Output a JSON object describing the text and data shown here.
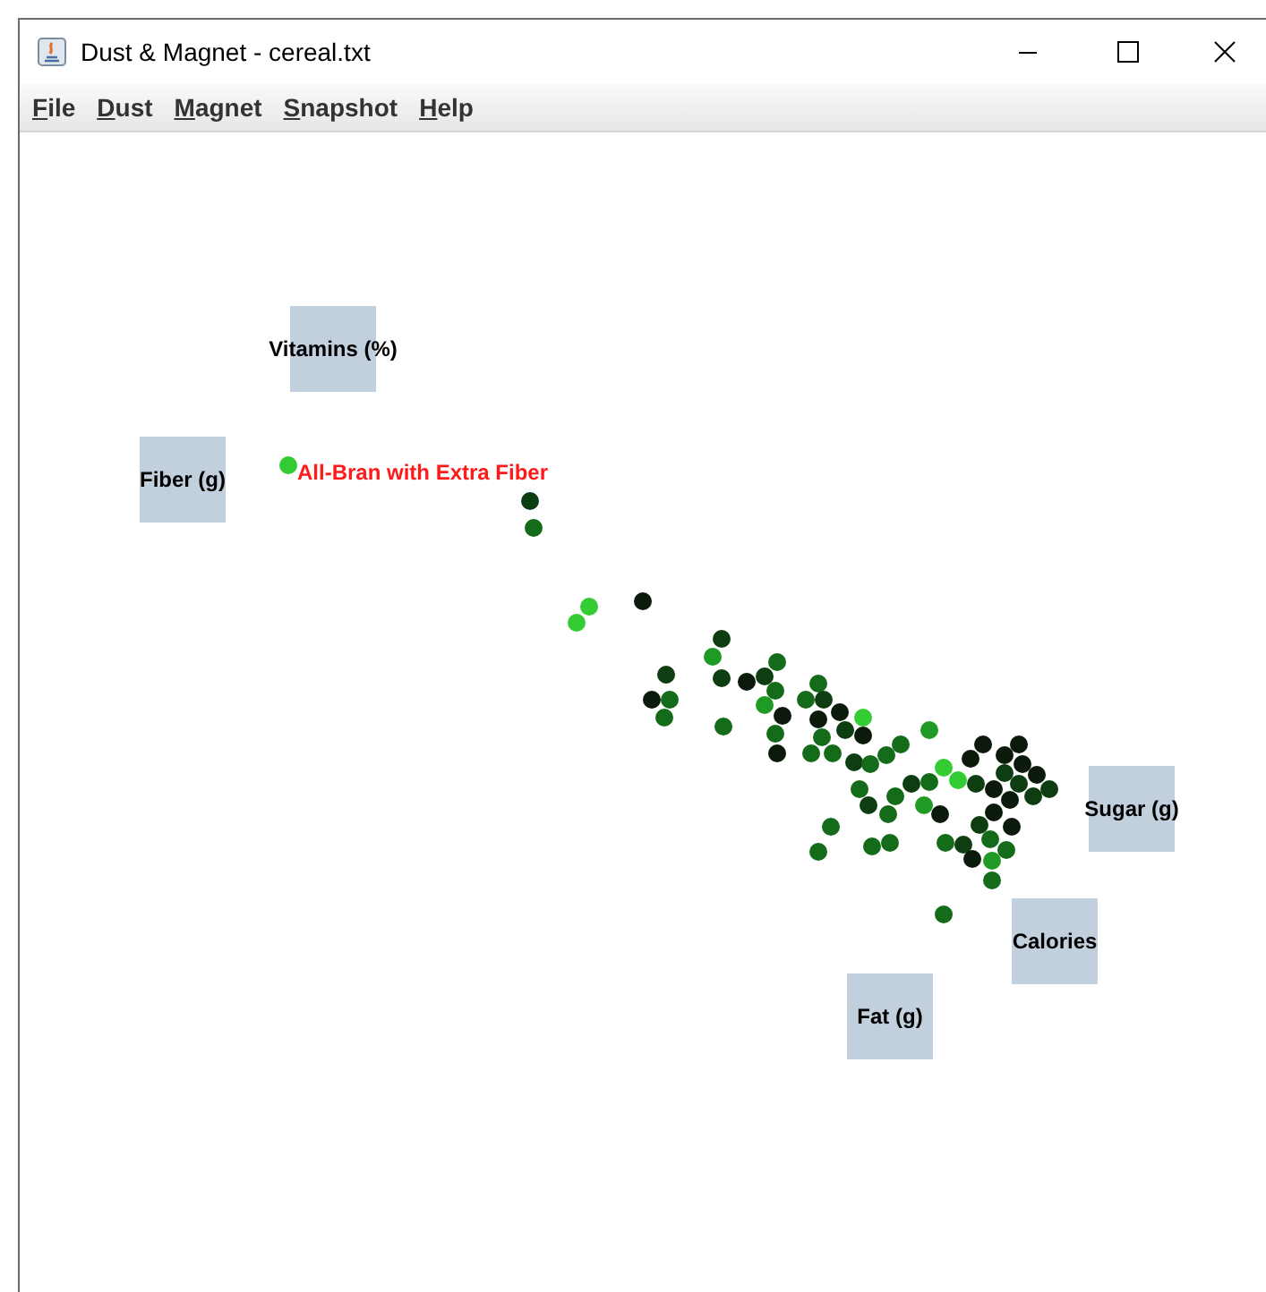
{
  "window": {
    "title": "Dust & Magnet - cereal.txt"
  },
  "menu": [
    {
      "label": "File"
    },
    {
      "label": "Dust"
    },
    {
      "label": "Magnet"
    },
    {
      "label": "Snapshot"
    },
    {
      "label": "Help"
    }
  ],
  "magnets": [
    {
      "label": "Vitamins (%)"
    },
    {
      "label": "Fiber (g)"
    },
    {
      "label": "Sugar (g)"
    },
    {
      "label": "Calories"
    },
    {
      "label": "Fat (g)"
    }
  ],
  "highlighted_dust": {
    "label": "All-Bran with Extra Fiber"
  }
}
